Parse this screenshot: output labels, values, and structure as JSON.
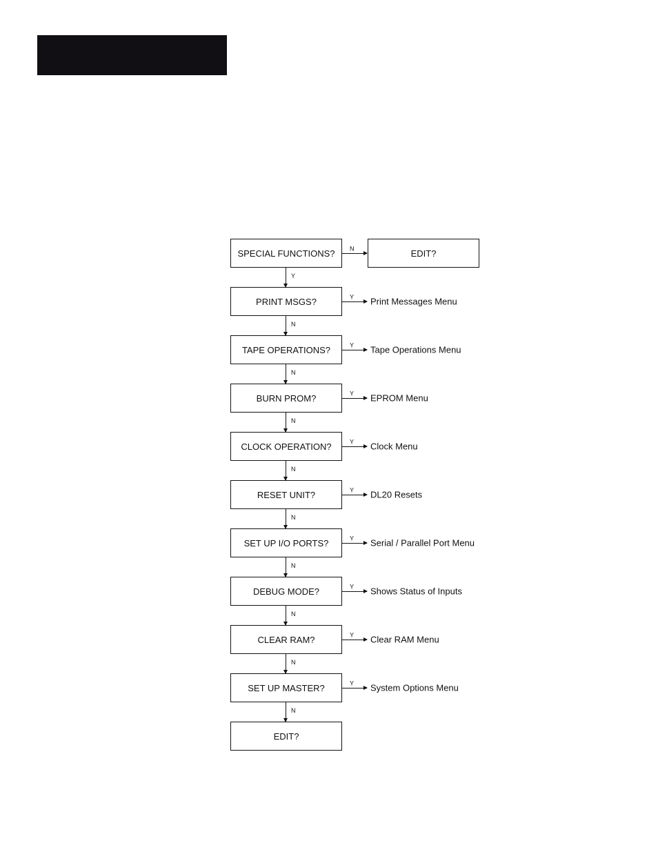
{
  "flow": {
    "first_down_label": "Y",
    "nodes": [
      {
        "text": "SPECIAL FUNCTIONS?",
        "right_type": "box",
        "right": "EDIT?",
        "right_label": "N",
        "down_label": ""
      },
      {
        "text": "PRINT MSGS?",
        "right_type": "text",
        "right": "Print Messages Menu",
        "right_label": "Y",
        "down_label": "N"
      },
      {
        "text": "TAPE OPERATIONS?",
        "right_type": "text",
        "right": "Tape Operations Menu",
        "right_label": "Y",
        "down_label": "N"
      },
      {
        "text": "BURN PROM?",
        "right_type": "text",
        "right": "EPROM Menu",
        "right_label": "Y",
        "down_label": "N"
      },
      {
        "text": "CLOCK OPERATION?",
        "right_type": "text",
        "right": "Clock Menu",
        "right_label": "Y",
        "down_label": "N"
      },
      {
        "text": "RESET UNIT?",
        "right_type": "text",
        "right": "DL20 Resets",
        "right_label": "Y",
        "down_label": "N"
      },
      {
        "text": "SET UP I/O PORTS?",
        "right_type": "text",
        "right": "Serial / Parallel Port Menu",
        "right_label": "Y",
        "down_label": "N"
      },
      {
        "text": "DEBUG MODE?",
        "right_type": "text",
        "right": "Shows Status of Inputs",
        "right_label": "Y",
        "down_label": "N"
      },
      {
        "text": "CLEAR RAM?",
        "right_type": "text",
        "right": "Clear RAM Menu",
        "right_label": "Y",
        "down_label": "N"
      },
      {
        "text": "SET UP MASTER?",
        "right_type": "text",
        "right": "System Options Menu",
        "right_label": "Y",
        "down_label": "N"
      },
      {
        "text": "EDIT?",
        "right_type": "none",
        "right": "",
        "right_label": "",
        "down_label": ""
      }
    ]
  }
}
